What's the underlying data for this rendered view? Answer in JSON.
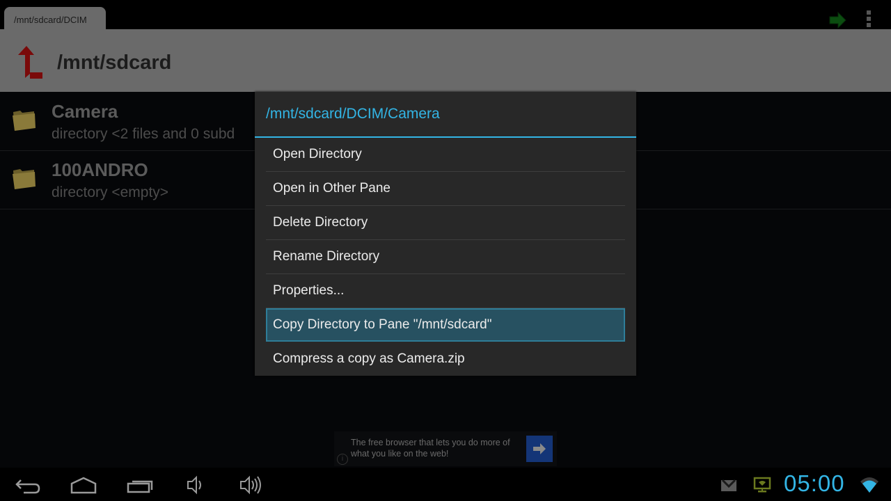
{
  "topbar": {
    "tab_label": "/mnt/sdcard/DCIM",
    "go_icon": "green-right-arrow-icon",
    "overflow_icon": "overflow-menu-icon"
  },
  "header": {
    "up_icon": "up-directory-icon",
    "path": "/mnt/sdcard"
  },
  "file_list": [
    {
      "name": "Camera",
      "description": "directory <2 files and 0 subd",
      "icon": "folder-icon"
    },
    {
      "name": "100ANDRO",
      "description": "directory <empty>",
      "icon": "folder-icon"
    }
  ],
  "context_menu": {
    "title": "/mnt/sdcard/DCIM/Camera",
    "items": [
      {
        "label": "Open Directory",
        "selected": false
      },
      {
        "label": "Open in Other Pane",
        "selected": false
      },
      {
        "label": "Delete Directory",
        "selected": false
      },
      {
        "label": "Rename Directory",
        "selected": false
      },
      {
        "label": "Properties...",
        "selected": false
      },
      {
        "label": "Copy Directory to Pane \"/mnt/sdcard\"",
        "selected": true
      },
      {
        "label": "Compress a copy as Camera.zip",
        "selected": false
      }
    ],
    "accent_color": "#33b5e5"
  },
  "ad": {
    "text": "The free browser that lets you do more of what you like on the web!",
    "info_glyph": "i"
  },
  "navbar": {
    "buttons": [
      "back",
      "home",
      "recent-apps",
      "volume-down",
      "volume-up"
    ],
    "status_icons": [
      "gmail-notification",
      "screen-cast-notification",
      "wifi"
    ],
    "clock": "05:00"
  }
}
